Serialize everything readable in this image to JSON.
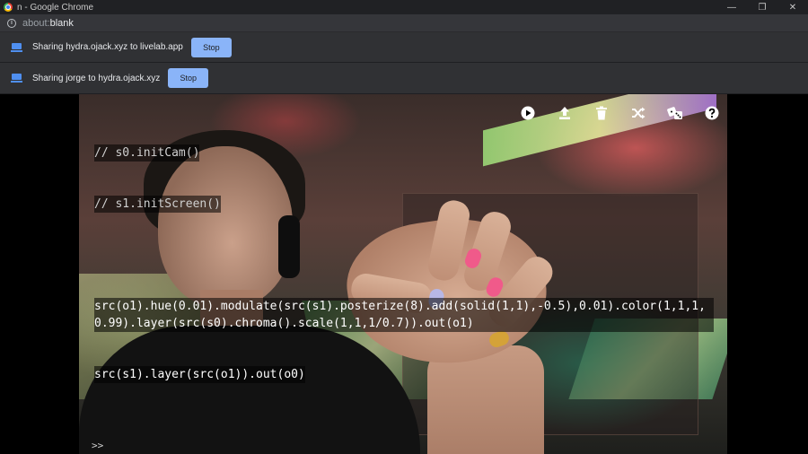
{
  "window": {
    "title": "n - Google Chrome",
    "controls": {
      "minimize": "—",
      "restore": "❐",
      "close": "✕"
    }
  },
  "address_bar": {
    "scheme": "about:",
    "host": "blank"
  },
  "sharing_bars": [
    {
      "text": "Sharing hydra.ojack.xyz to livelab.app",
      "button": "Stop"
    },
    {
      "text": "Sharing jorge to hydra.ojack.xyz",
      "button": "Stop"
    }
  ],
  "hydra": {
    "toolbar": [
      {
        "name": "run",
        "icon": "play-icon"
      },
      {
        "name": "upload",
        "icon": "upload-icon"
      },
      {
        "name": "clear",
        "icon": "trash-icon"
      },
      {
        "name": "shuffle",
        "icon": "shuffle-icon"
      },
      {
        "name": "random",
        "icon": "dice-icon"
      },
      {
        "name": "help",
        "icon": "help-icon"
      }
    ],
    "code": {
      "comment1": "// s0.initCam()",
      "comment2": "// s1.initScreen()",
      "line1": "src(o1).hue(0.01).modulate(src(s1).posterize(8).add(solid(1,1),-0.5),0.01).color(1,1,1,0.99).layer(src(s0).chroma().scale(1,1,1/0.7)).out(o1)",
      "line2": "src(s1).layer(src(o1)).out(o0)"
    },
    "prompt": ">>"
  },
  "colors": {
    "titlebar": "#202124",
    "addressbar": "#35363a",
    "sharebar": "#303134",
    "stop_button": "#8ab4f8",
    "share_icon": "#4f8ff0"
  }
}
